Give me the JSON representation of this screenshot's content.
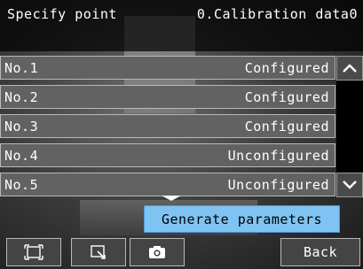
{
  "header": {
    "title": "Specify point",
    "subtitle": "0.Calibration data0"
  },
  "points": [
    {
      "label": "No.1",
      "status": "Configured"
    },
    {
      "label": "No.2",
      "status": "Configured"
    },
    {
      "label": "No.3",
      "status": "Configured"
    },
    {
      "label": "No.4",
      "status": "Unconfigured"
    },
    {
      "label": "No.5",
      "status": "Unconfigured"
    }
  ],
  "actions": {
    "generate_label": "Generate parameters",
    "back_label": "Back"
  },
  "icons": {
    "scroll_up": "chevron-up-icon",
    "scroll_down": "chevron-down-icon",
    "more": "triangle-down-icon",
    "tool1": "fit-frame-icon",
    "tool2": "zoom-region-icon",
    "tool3": "camera-icon"
  },
  "colors": {
    "row_bg": "#626262",
    "generate_bg": "#7fc3f2"
  }
}
